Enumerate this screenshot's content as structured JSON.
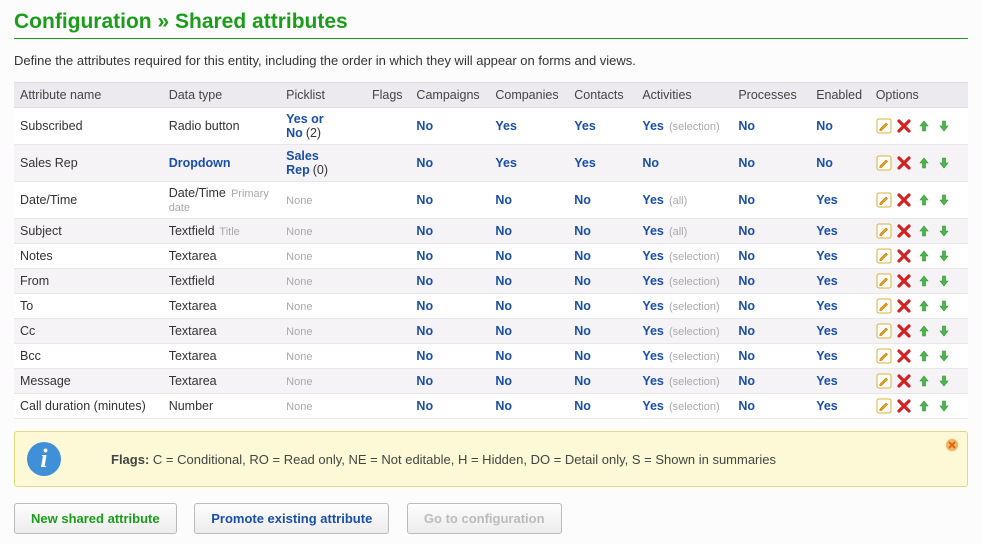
{
  "title_a": "Configuration",
  "title_sep": " » ",
  "title_b": "Shared attributes",
  "intro": "Define the attributes required for this entity, including the order in which they will appear on forms and views.",
  "headers": {
    "name": "Attribute name",
    "type": "Data type",
    "pick": "Picklist",
    "flags": "Flags",
    "camp": "Campaigns",
    "comp": "Companies",
    "cont": "Contacts",
    "act": "Activities",
    "proc": "Processes",
    "en": "Enabled",
    "opt": "Options"
  },
  "rows": [
    {
      "name": "Subscribed",
      "type": "Radio button",
      "type_note": "",
      "pick": "Yes or No",
      "pick_count": "(2)",
      "camp": "No",
      "comp": "Yes",
      "cont": "Yes",
      "act": "Yes",
      "act_note": "(selection)",
      "proc": "No",
      "en": "No"
    },
    {
      "name": "Sales Rep",
      "type": "Dropdown",
      "type_link": true,
      "type_note": "",
      "pick": "Sales Rep",
      "pick_count": "(0)",
      "camp": "No",
      "comp": "Yes",
      "cont": "Yes",
      "act": "No",
      "act_note": "",
      "proc": "No",
      "en": "No"
    },
    {
      "name": "Date/Time",
      "type": "Date/Time",
      "type_note": "Primary date",
      "pick": "None",
      "camp": "No",
      "comp": "No",
      "cont": "No",
      "act": "Yes",
      "act_note": "(all)",
      "proc": "No",
      "en": "Yes"
    },
    {
      "name": "Subject",
      "type": "Textfield",
      "type_note": "Title",
      "pick": "None",
      "camp": "No",
      "comp": "No",
      "cont": "No",
      "act": "Yes",
      "act_note": "(all)",
      "proc": "No",
      "en": "Yes"
    },
    {
      "name": "Notes",
      "type": "Textarea",
      "type_note": "",
      "pick": "None",
      "camp": "No",
      "comp": "No",
      "cont": "No",
      "act": "Yes",
      "act_note": "(selection)",
      "proc": "No",
      "en": "Yes"
    },
    {
      "name": "From",
      "type": "Textfield",
      "type_note": "",
      "pick": "None",
      "camp": "No",
      "comp": "No",
      "cont": "No",
      "act": "Yes",
      "act_note": "(selection)",
      "proc": "No",
      "en": "Yes"
    },
    {
      "name": "To",
      "type": "Textarea",
      "type_note": "",
      "pick": "None",
      "camp": "No",
      "comp": "No",
      "cont": "No",
      "act": "Yes",
      "act_note": "(selection)",
      "proc": "No",
      "en": "Yes"
    },
    {
      "name": "Cc",
      "type": "Textarea",
      "type_note": "",
      "pick": "None",
      "camp": "No",
      "comp": "No",
      "cont": "No",
      "act": "Yes",
      "act_note": "(selection)",
      "proc": "No",
      "en": "Yes"
    },
    {
      "name": "Bcc",
      "type": "Textarea",
      "type_note": "",
      "pick": "None",
      "camp": "No",
      "comp": "No",
      "cont": "No",
      "act": "Yes",
      "act_note": "(selection)",
      "proc": "No",
      "en": "Yes"
    },
    {
      "name": "Message",
      "type": "Textarea",
      "type_note": "",
      "pick": "None",
      "camp": "No",
      "comp": "No",
      "cont": "No",
      "act": "Yes",
      "act_note": "(selection)",
      "proc": "No",
      "en": "Yes"
    },
    {
      "name": "Call duration (minutes)",
      "type": "Number",
      "type_note": "",
      "pick": "None",
      "camp": "No",
      "comp": "No",
      "cont": "No",
      "act": "Yes",
      "act_note": "(selection)",
      "proc": "No",
      "en": "Yes"
    }
  ],
  "info": {
    "label": "Flags:",
    "text": " C = Conditional, RO = Read only, NE = Not editable, H = Hidden, DO = Detail only, S = Shown in summaries"
  },
  "buttons": {
    "new": "New shared attribute",
    "promote": "Promote existing attribute",
    "goto": "Go to configuration"
  }
}
